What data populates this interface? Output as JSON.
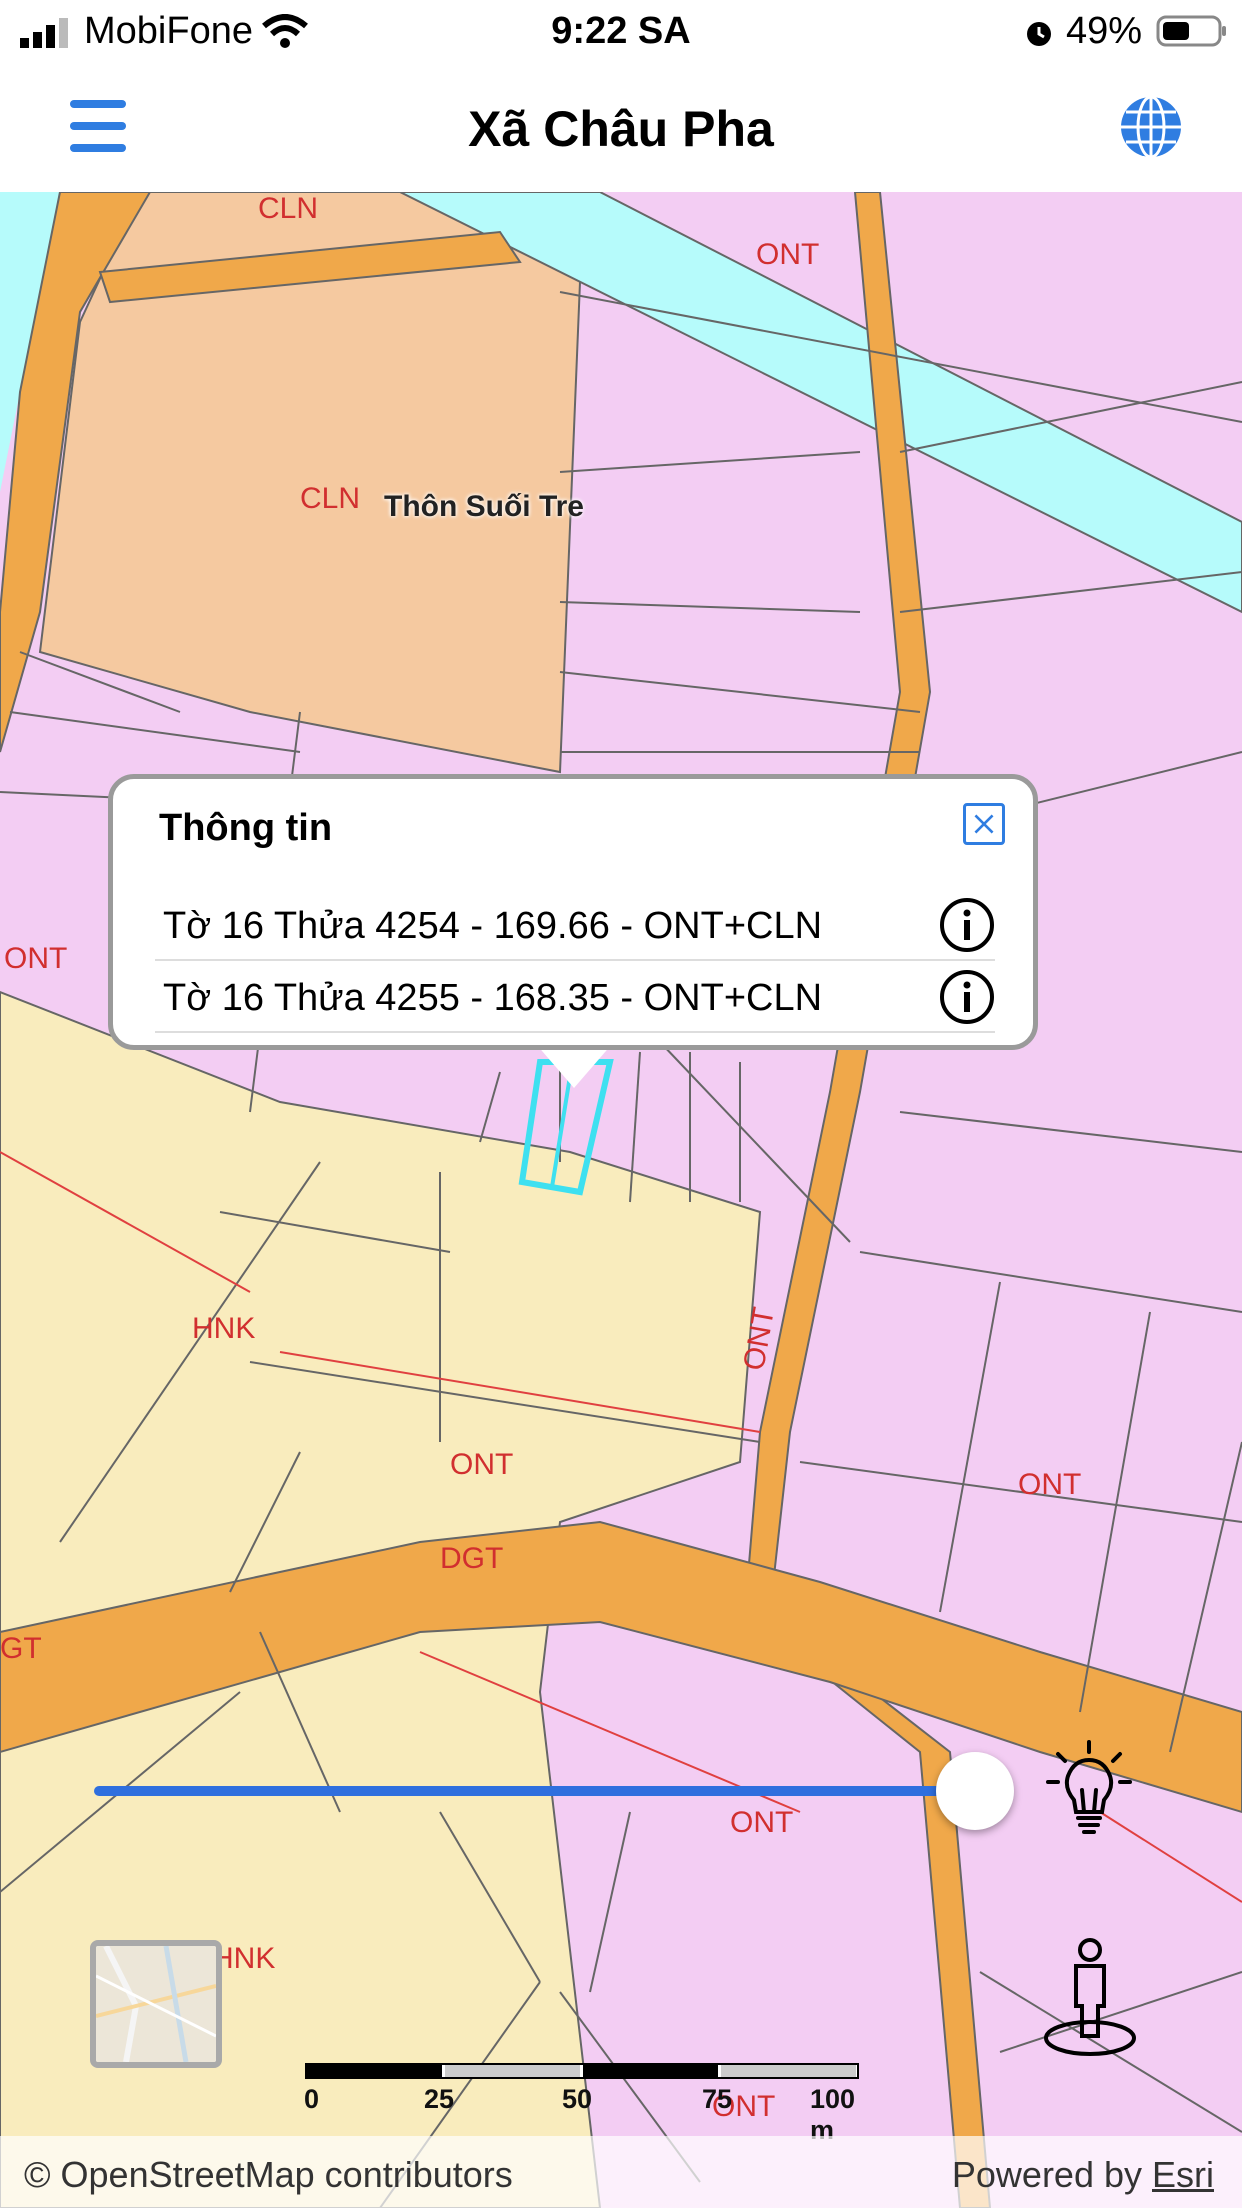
{
  "status_bar": {
    "carrier": "MobiFone",
    "time": "9:22 SA",
    "battery_percent": "49%"
  },
  "nav": {
    "title": "Xã Châu Pha",
    "menu_icon": "hamburger-menu-icon",
    "globe_icon": "globe-icon"
  },
  "map": {
    "labels": {
      "cln_1": "CLN",
      "cln_2": "CLN",
      "ont_top": "ONT",
      "ont_left": "ONT",
      "ont_vertical": "ONT",
      "hnk_1": "HNK",
      "hnk_2": "HNK",
      "ont_mid": "ONT",
      "ont_right": "ONT",
      "dgt_1": "DGT",
      "dgt_2": "GT",
      "ont_bottom": "ONT",
      "ont_bottom2": "ONT"
    },
    "place_name": "Thôn Suối Tre",
    "colors": {
      "residential": "#f3cdf3",
      "agricultural": "#f9ecbd",
      "perennial": "#f5c9a0",
      "road": "#f0a84a",
      "water": "#b6fbfb"
    }
  },
  "popup": {
    "title": "Thông tin",
    "close_icon": "close-icon",
    "rows": [
      {
        "text": "Tờ 16 Thửa 4254 - 169.66 - ONT+CLN",
        "icon": "info-icon"
      },
      {
        "text": "Tờ 16 Thửa 4255 - 168.35 - ONT+CLN",
        "icon": "info-icon"
      }
    ]
  },
  "controls": {
    "opacity_slider_value": 1.0,
    "bulb_icon": "lightbulb-icon",
    "person_icon": "street-view-person-icon",
    "basemap_icon": "basemap-thumbnail"
  },
  "scalebar": {
    "labels": [
      "0",
      "25",
      "50",
      "75",
      "100 m"
    ]
  },
  "attribution": {
    "left": "© OpenStreetMap contributors",
    "right_prefix": "Powered by ",
    "right_link": "Esri"
  }
}
